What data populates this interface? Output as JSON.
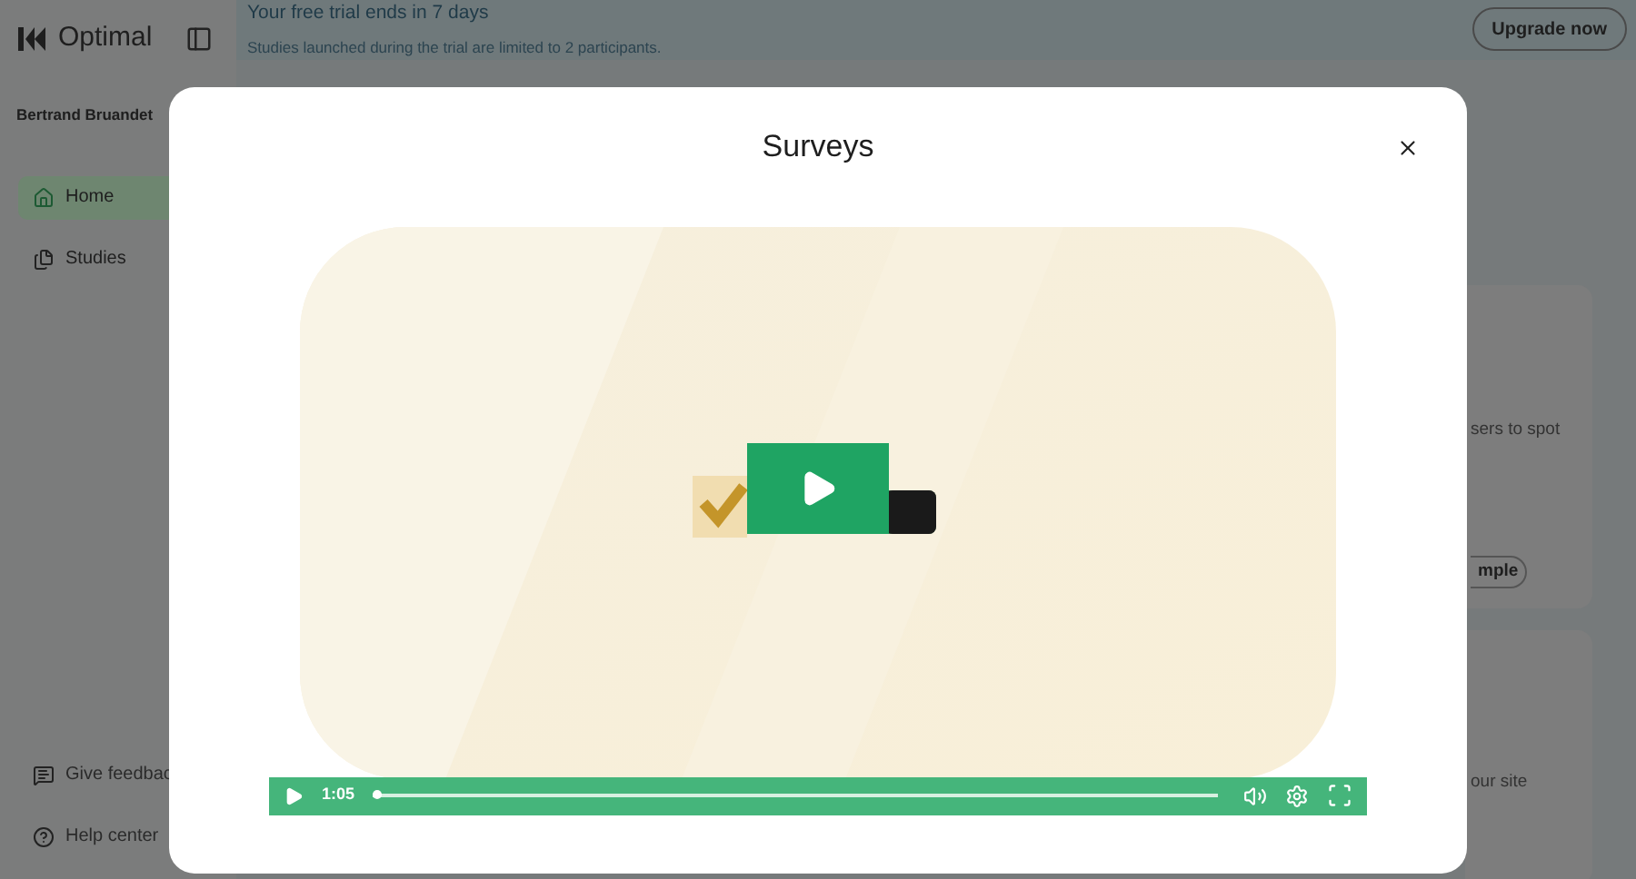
{
  "app": {
    "logo": "Optimal",
    "user": "Bertrand Bruandet",
    "nav": [
      {
        "label": "Home",
        "selected": true
      },
      {
        "label": "Studies",
        "selected": false
      }
    ],
    "footer": [
      {
        "label": "Give feedbac"
      },
      {
        "label": "Help center"
      }
    ]
  },
  "banner": {
    "title": "Your free trial ends in 7 days",
    "subtitle": "Studies launched during the trial are limited to 2 participants.",
    "button": "Upgrade now"
  },
  "cards": [
    {
      "text": "sers to spot",
      "button": "mple"
    },
    {
      "text": "our site"
    }
  ],
  "modal": {
    "title": "Surveys",
    "video": {
      "kind": "picture",
      "time": "1:05",
      "level": 0.005
    }
  }
}
